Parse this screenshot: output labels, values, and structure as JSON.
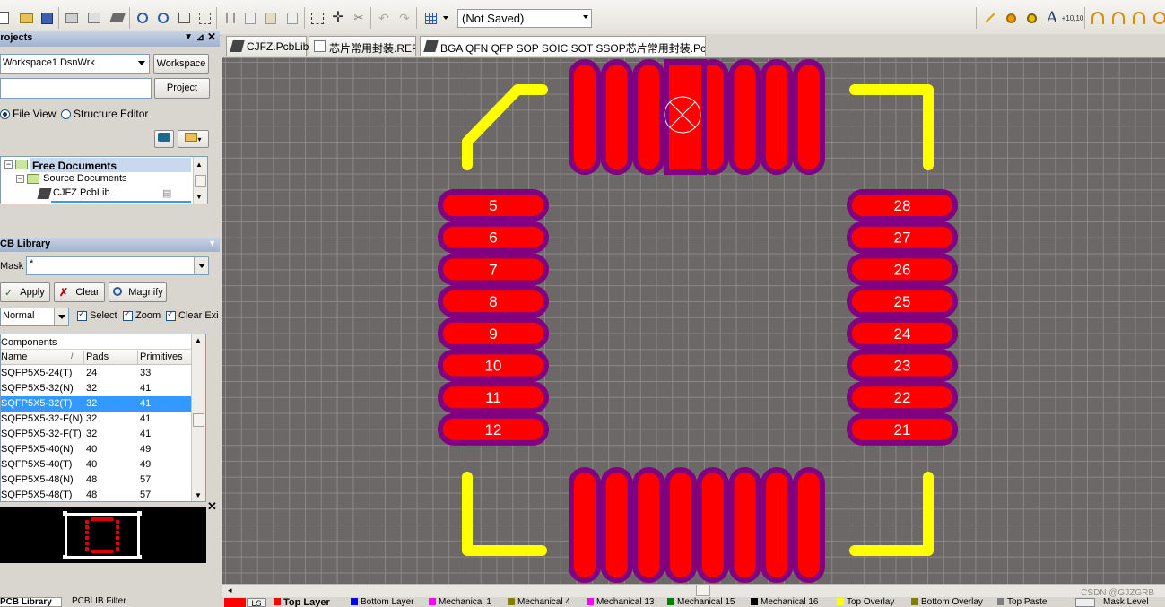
{
  "toolbar": {
    "document_state": "(Not Saved)"
  },
  "projects_panel": {
    "title": "Projects",
    "workspace_value": "Workspace1.DsnWrk",
    "workspace_button": "Workspace",
    "project_button": "Project",
    "file_view_label": "File View",
    "structure_editor_label": "Structure Editor",
    "tree": {
      "free_documents": "Free Documents",
      "source_documents": "Source Documents",
      "file": "CJFZ.PcbLib"
    }
  },
  "pcb_library_panel": {
    "title": "CB Library",
    "mask_label": "Mask",
    "mask_value": "*",
    "apply_button": "Apply",
    "clear_button": "Clear",
    "magnify_button": "Magnify",
    "mode_value": "Normal",
    "select_label": "Select",
    "zoom_label": "Zoom",
    "clear_existing_label": "Clear Exi",
    "components_header": "Components",
    "columns": [
      "Name",
      "Pads",
      "Primitives"
    ],
    "rows": [
      {
        "name": "SQFP5X5-24(T)",
        "pads": "24",
        "primitives": "33"
      },
      {
        "name": "SQFP5X5-32(N)",
        "pads": "32",
        "primitives": "41"
      },
      {
        "name": "SQFP5X5-32(T)",
        "pads": "32",
        "primitives": "41"
      },
      {
        "name": "SQFP5X5-32-F(N)",
        "pads": "32",
        "primitives": "41"
      },
      {
        "name": "SQFP5X5-32-F(T)",
        "pads": "32",
        "primitives": "41"
      },
      {
        "name": "SQFP5X5-40(N)",
        "pads": "40",
        "primitives": "49"
      },
      {
        "name": "SQFP5X5-40(T)",
        "pads": "40",
        "primitives": "49"
      },
      {
        "name": "SQFP5X5-48(N)",
        "pads": "48",
        "primitives": "57"
      },
      {
        "name": "SQFP5X5-48(T)",
        "pads": "48",
        "primitives": "57"
      }
    ],
    "selected_row": 2
  },
  "bottom_tabs": [
    "PCB Library",
    "PCBLIB Filter"
  ],
  "doc_tabs": [
    {
      "label": "CJFZ.PcbLib"
    },
    {
      "label": "芯片常用封装.REP"
    },
    {
      "label": "BGA QFN QFP SOP SOIC SOT SSOP芯片常用封装.PcbLib *"
    }
  ],
  "pcb": {
    "left_pads": [
      "5",
      "6",
      "7",
      "8",
      "9",
      "10",
      "11",
      "12"
    ],
    "right_pads": [
      "28",
      "27",
      "26",
      "25",
      "24",
      "23",
      "22",
      "21"
    ],
    "colors": {
      "pad": "#ff0000",
      "pad_mask": "#800080",
      "overlay": "#ffff00",
      "background": "#6c6868"
    }
  },
  "layer_bar": {
    "ls_label": "LS",
    "layers": [
      {
        "name": "Top Layer",
        "color": "#ff0000"
      },
      {
        "name": "Bottom Layer",
        "color": "#0000ff"
      },
      {
        "name": "Mechanical 1",
        "color": "#ff00ff"
      },
      {
        "name": "Mechanical 4",
        "color": "#808000"
      },
      {
        "name": "Mechanical 13",
        "color": "#ff00ff"
      },
      {
        "name": "Mechanical 15",
        "color": "#008000"
      },
      {
        "name": "Mechanical 16",
        "color": "#000000"
      },
      {
        "name": "Top Overlay",
        "color": "#ffff00"
      },
      {
        "name": "Bottom Overlay",
        "color": "#808000"
      },
      {
        "name": "Top Paste",
        "color": "#808080"
      }
    ],
    "mask_level": "Mask Level"
  },
  "watermark": "CSDN @GJZGRB"
}
